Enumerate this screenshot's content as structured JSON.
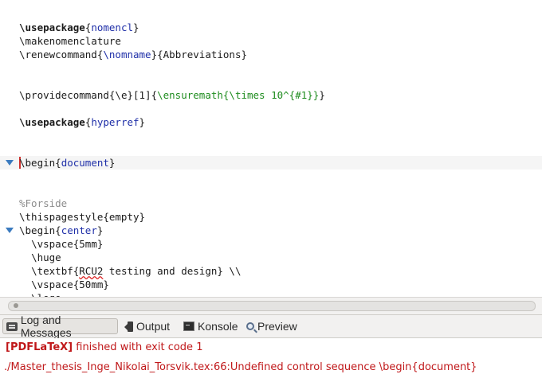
{
  "editor": {
    "lines": [
      {
        "y": 0,
        "parts": []
      },
      {
        "y": 1,
        "parts": [
          [
            "cmd-bold",
            "\\usepackage"
          ],
          [
            "plain",
            "{"
          ],
          [
            "arg-blue",
            "nomencl"
          ],
          [
            "plain",
            "}"
          ]
        ]
      },
      {
        "y": 2,
        "parts": [
          [
            "cmd",
            "\\makenomenclature"
          ]
        ]
      },
      {
        "y": 3,
        "parts": [
          [
            "cmd",
            "\\renewcommand"
          ],
          [
            "plain",
            "{"
          ],
          [
            "arg-blue",
            "\\nomname"
          ],
          [
            "plain",
            "}{Abbreviations}"
          ]
        ]
      },
      {
        "y": 6,
        "parts": [
          [
            "cmd",
            "\\providecommand"
          ],
          [
            "plain",
            "{\\e}[1]{"
          ],
          [
            "arg-green",
            "\\ensuremath{\\times 10^{#1}}"
          ],
          [
            "plain",
            "}"
          ]
        ]
      },
      {
        "y": 8,
        "parts": [
          [
            "cmd-bold",
            "\\usepackage"
          ],
          [
            "plain",
            "{"
          ],
          [
            "arg-blue",
            "hyperref"
          ],
          [
            "plain",
            "}"
          ]
        ]
      },
      {
        "y": 11,
        "fold": true,
        "current": true,
        "caret": true,
        "parts": [
          [
            "cmd",
            "\\begin"
          ],
          [
            "plain",
            "{"
          ],
          [
            "arg-blue",
            "document"
          ],
          [
            "plain",
            "}"
          ]
        ]
      },
      {
        "y": 14,
        "parts": [
          [
            "comment",
            "%Forside"
          ]
        ]
      },
      {
        "y": 15,
        "parts": [
          [
            "cmd",
            "\\thispagestyle"
          ],
          [
            "plain",
            "{empty}"
          ]
        ]
      },
      {
        "y": 16,
        "fold": true,
        "parts": [
          [
            "cmd",
            "\\begin"
          ],
          [
            "plain",
            "{"
          ],
          [
            "arg-blue",
            "center"
          ],
          [
            "plain",
            "}"
          ]
        ]
      },
      {
        "y": 17,
        "parts": [
          [
            "plain",
            "  "
          ],
          [
            "cmd",
            "\\vspace"
          ],
          [
            "plain",
            "{5mm}"
          ]
        ]
      },
      {
        "y": 18,
        "parts": [
          [
            "plain",
            "  "
          ],
          [
            "cmd",
            "\\huge"
          ]
        ]
      },
      {
        "y": 19,
        "parts": [
          [
            "plain",
            "  "
          ],
          [
            "cmd",
            "\\textbf"
          ],
          [
            "plain",
            "{"
          ],
          [
            "spell",
            "RCU2"
          ],
          [
            "plain",
            " testing and design} \\\\"
          ]
        ]
      },
      {
        "y": 20,
        "parts": [
          [
            "plain",
            "  "
          ],
          [
            "cmd",
            "\\vspace"
          ],
          [
            "plain",
            "{50mm}"
          ]
        ]
      },
      {
        "y": 21,
        "parts": [
          [
            "plain",
            "  "
          ],
          [
            "cmd",
            "\\logo"
          ]
        ]
      }
    ]
  },
  "tabs": [
    {
      "label": "Log and Messages",
      "icon": "log-icon",
      "active": true
    },
    {
      "label": "Output",
      "icon": "output-icon",
      "active": false
    },
    {
      "label": "Konsole",
      "icon": "konsole-icon",
      "active": false
    },
    {
      "label": "Preview",
      "icon": "preview-icon",
      "active": false
    }
  ],
  "log": {
    "line1_tag": "[PDFLaTeX]",
    "line1_text": " finished with exit code 1",
    "line2_text": "./Master_thesis_Inge_Nikolai_Torsvik.tex:66:Undefined control sequence \\begin{document}"
  },
  "colors": {
    "error_red": "#c0181a",
    "fold_arrow": "#3b7bbf",
    "keyword_blue": "#1f2fa8",
    "math_green": "#1e8c1e",
    "comment_gray": "#8c8c8c"
  }
}
